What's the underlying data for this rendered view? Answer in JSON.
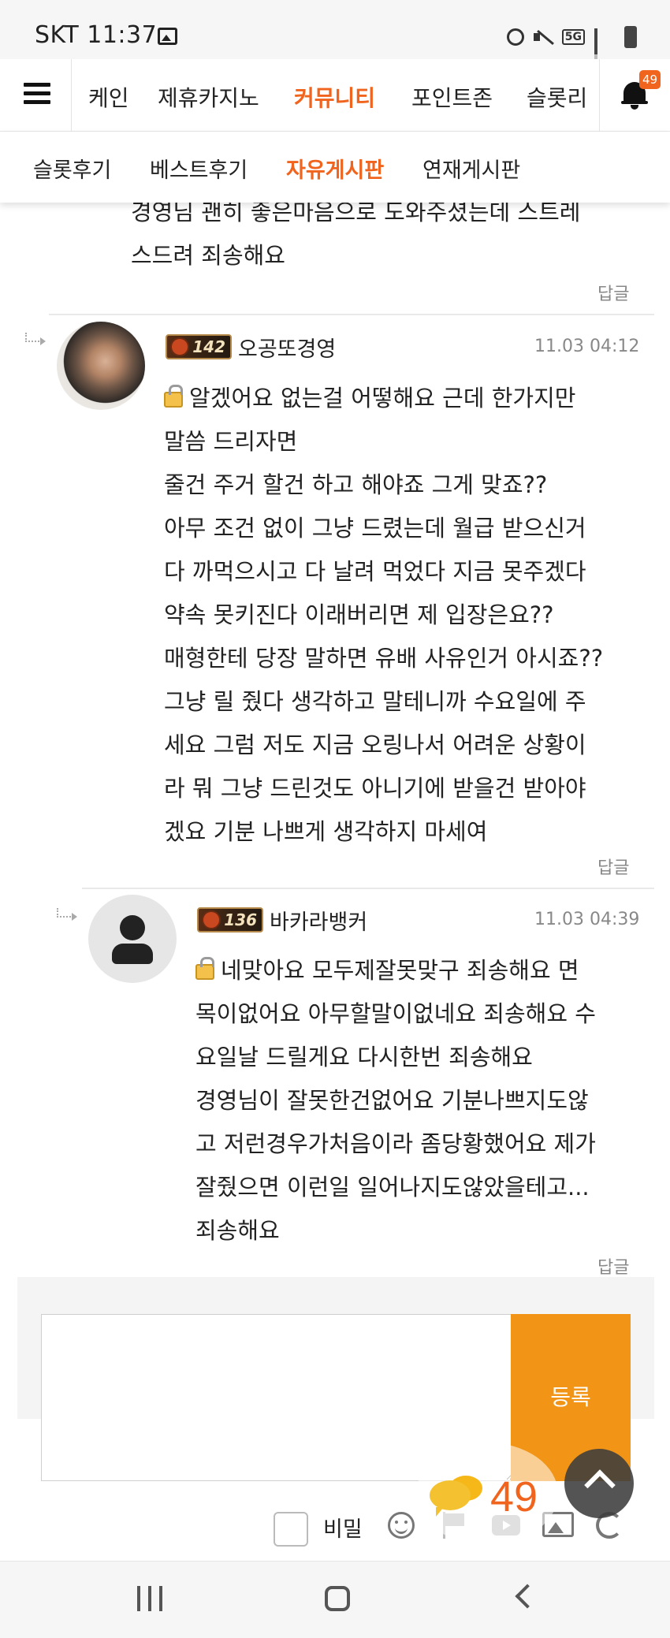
{
  "status_bar": {
    "carrier_time": "SKT 11:37",
    "network": "5G"
  },
  "top_nav": {
    "items": [
      {
        "label": "케인"
      },
      {
        "label": "제휴카지노"
      },
      {
        "label": "커뮤니티",
        "active": true
      },
      {
        "label": "포인트존"
      },
      {
        "label": "슬롯리"
      }
    ],
    "notification_count": "49"
  },
  "sub_nav": {
    "items": [
      {
        "label": "슬롯후기"
      },
      {
        "label": "베스트후기"
      },
      {
        "label": "자유게시판",
        "active": true
      },
      {
        "label": "연재게시판"
      }
    ]
  },
  "comments": [
    {
      "partial": true,
      "lines": [
        "경영님 괜히 좋은마음으로 도와주셨는데 스트레",
        "스드려 죄송해요"
      ],
      "reply_label": "답글"
    },
    {
      "level": "142",
      "nickname": "오공또경영",
      "date": "11.03 04:12",
      "secret": true,
      "lines": [
        "알겠어요 없는걸 어떻해요 근데 한가지만",
        "말씀 드리자면",
        "줄건 주거 할건 하고 해야죠 그게 맞죠??",
        "아무 조건 없이 그냥 드렸는데 월급 받으신거",
        "다 까먹으시고 다 날려 먹었다 지금 못주겠다",
        "약속 못키진다 이래버리면 제 입장은요??",
        "매형한테 당장 말하면 유배 사유인거 아시죠??",
        "그냥 릴 줬다 생각하고 말테니까 수요일에 주",
        "세요 그럼 저도 지금 오링나서 어려운 상황이",
        "라 뭐 그냥 드린것도 아니기에 받을건 받아야",
        "겠요 기분 나쁘게 생각하지 마세여"
      ],
      "reply_label": "답글"
    },
    {
      "level": "136",
      "nickname": "바카라뱅커",
      "date": "11.03 04:39",
      "secret": true,
      "lines": [
        "네맞아요 모두제잘못맞구 죄송해요  면",
        "목이없어요 아무할말이없네요 죄송해요 수",
        "요일날 드릴게요 다시한번 죄송해요",
        "경영님이 잘못한건없어요 기분나쁘지도않",
        "고 저런경우가처음이라 좀당황했어요 제가",
        "잘줬으면 이런일 일어나지도않았을테고...",
        "죄송해요"
      ],
      "reply_label": "답글"
    }
  ],
  "comment_form": {
    "textarea_value": "",
    "submit_label": "등록",
    "secret_label": "비밀",
    "secret_checked": false
  },
  "floating": {
    "chat_count": "49"
  },
  "icons": [
    "hamburger-icon",
    "bell-icon",
    "lock-icon",
    "emoji-icon",
    "flag-icon",
    "video-icon",
    "image-icon",
    "refresh-icon",
    "chat-icon",
    "arrow-up-icon"
  ],
  "colors": {
    "accent": "#f0641e",
    "submit": "#f29516",
    "muted": "#888888"
  }
}
